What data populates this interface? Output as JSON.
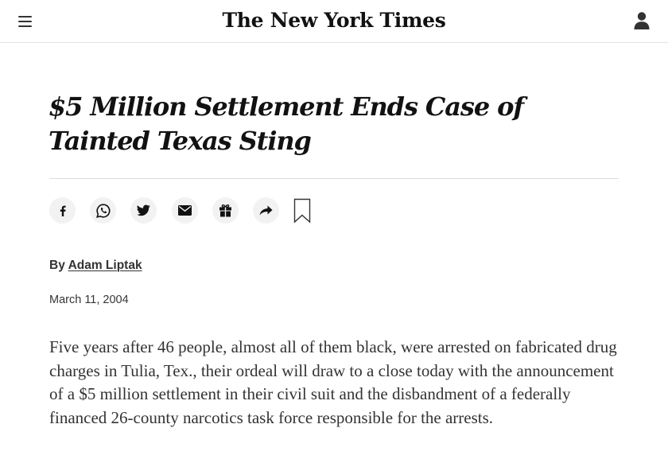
{
  "header": {
    "masthead": "The New York Times",
    "menu_icon": "hamburger-menu-icon",
    "account_icon": "person-icon"
  },
  "article": {
    "headline": "$5 Million Settlement Ends Case of Tainted Texas Sting",
    "share_buttons": [
      {
        "icon": "facebook-icon"
      },
      {
        "icon": "whatsapp-icon"
      },
      {
        "icon": "twitter-icon"
      },
      {
        "icon": "email-icon"
      },
      {
        "icon": "gift-icon"
      },
      {
        "icon": "share-arrow-icon"
      }
    ],
    "bookmark_icon": "bookmark-icon",
    "byline_prefix": "By",
    "author": "Adam Liptak",
    "date": "March 11, 2004",
    "lede": "Five years after 46 people, almost all of them black, were arrested on fabricated drug charges in Tulia, Tex., their ordeal will draw to a close today with the announcement of a $5 million settlement in their civil suit and the disbandment of a federally financed 26-county narcotics task force responsible for the arrests."
  },
  "colors": {
    "text": "#121212",
    "body_text": "#333333",
    "icon_bg": "#f2f2f2",
    "divider": "#e2e2e2"
  }
}
